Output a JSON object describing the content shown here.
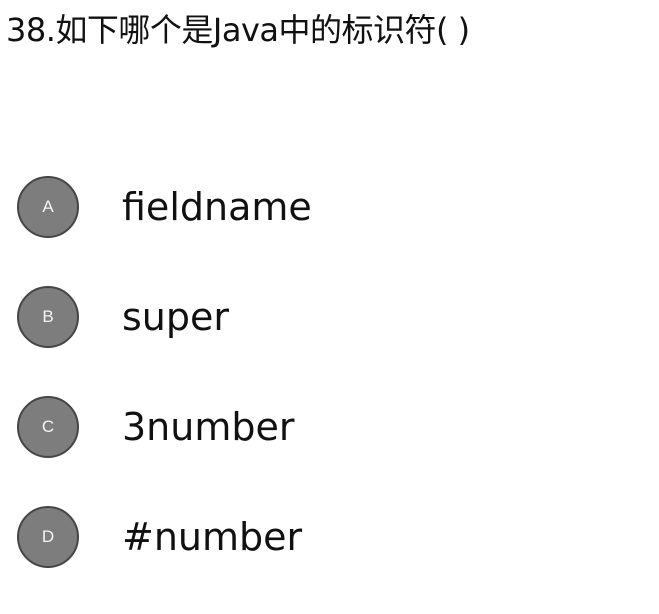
{
  "question": {
    "text": "38.如下哪个是Java中的标识符(  )"
  },
  "options": [
    {
      "letter": "A",
      "text": "fieldname"
    },
    {
      "letter": "B",
      "text": "super"
    },
    {
      "letter": "C",
      "text": "3number"
    },
    {
      "letter": "D",
      "text": "#number"
    }
  ],
  "colors": {
    "badge_fill": "#7d7d7d",
    "badge_border": "#454545",
    "text": "#111111"
  }
}
